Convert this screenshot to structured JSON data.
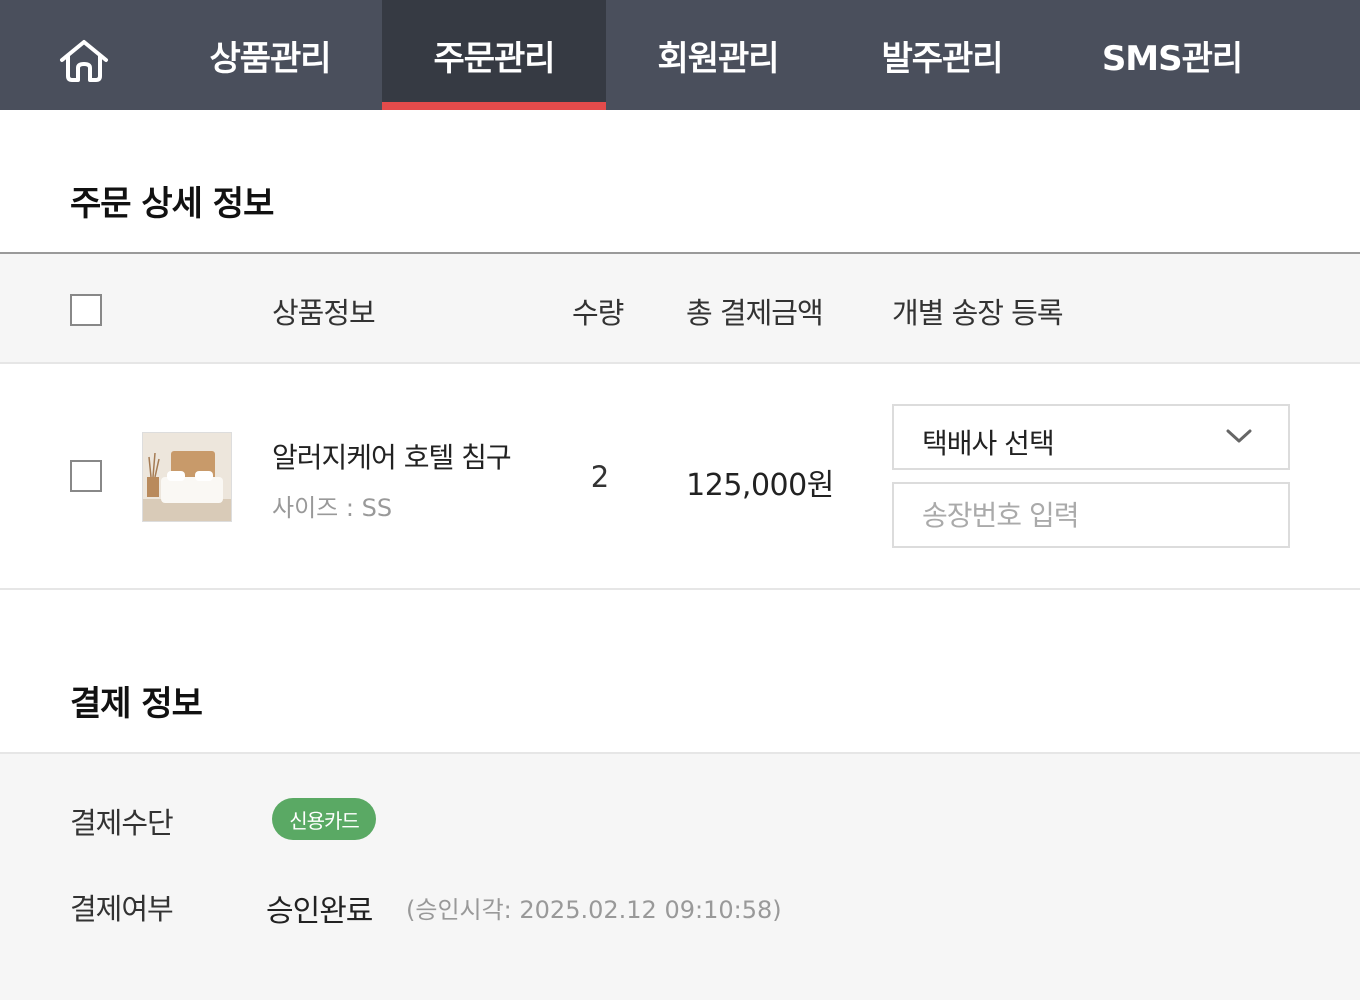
{
  "nav": {
    "home_icon": "home-icon",
    "tabs": [
      {
        "label": "상품관리"
      },
      {
        "label": "주문관리",
        "active": true
      },
      {
        "label": "회원관리"
      },
      {
        "label": "발주관리"
      },
      {
        "label": "SMS관리"
      }
    ],
    "active_color": "#e34b4b",
    "bg_color": "#4a4f5c"
  },
  "order": {
    "title": "주문 상세 정보",
    "columns": {
      "product": "상품정보",
      "qty": "수량",
      "total": "총 결제금액",
      "invoice": "개별 송장 등록"
    },
    "items": [
      {
        "name": "알러지케어 호텔 침구",
        "option": "사이즈 : SS",
        "qty": "2",
        "price": "125,000원",
        "courier_select": "택배사 선택",
        "invoice_placeholder": "송장번호 입력"
      }
    ]
  },
  "payment": {
    "title": "결제 정보",
    "method_label": "결제수단",
    "method_value": "신용카드",
    "method_color": "#5aa964",
    "status_label": "결제여부",
    "status_value": "승인완료",
    "approved_time": "(승인시각: 2025.02.12 09:10:58)"
  }
}
